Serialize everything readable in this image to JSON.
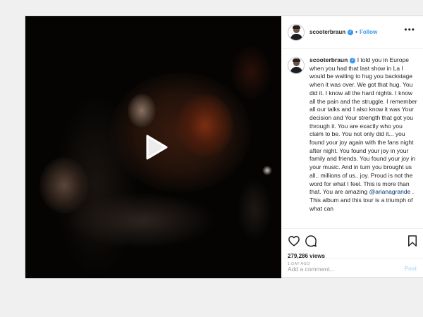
{
  "post": {
    "username": "scooterbraun",
    "follow_label": "Follow",
    "separator": "•",
    "more_label": "•••",
    "caption_username": "scooterbraun",
    "caption_before": " I told you in Europe when you had that last show in La I would be waiting to hug you backstage when it was over. We got that hug. You did it. I know all the hard nights. I know all the pain and the struggle. I remember all our talks and I also know it was Your decision and Your strength that got you through it. You are exactly who you claim to be. You not only did it... you found your joy again with the fans night after night. You found your joy in your family and friends. You found your joy in your music. And in turn you brought us all.. millions of us.. joy. Proud is not the word for what I feel. This is more than that. You are amazing ",
    "mention": "@arianagrande",
    "caption_after": " . This album and this tour is a triumph of what can",
    "views": "279,286 views",
    "date": "1 DAY AGO",
    "comment_placeholder": "Add a comment...",
    "post_label": "Post"
  },
  "icons": {
    "play": "play-icon",
    "like": "heart-icon",
    "comment": "comment-icon",
    "share": "share-icon",
    "save": "bookmark-icon"
  },
  "colors": {
    "accent": "#3897f0",
    "text": "#262626",
    "muted": "#999999",
    "post_disabled": "#b2dffc"
  }
}
